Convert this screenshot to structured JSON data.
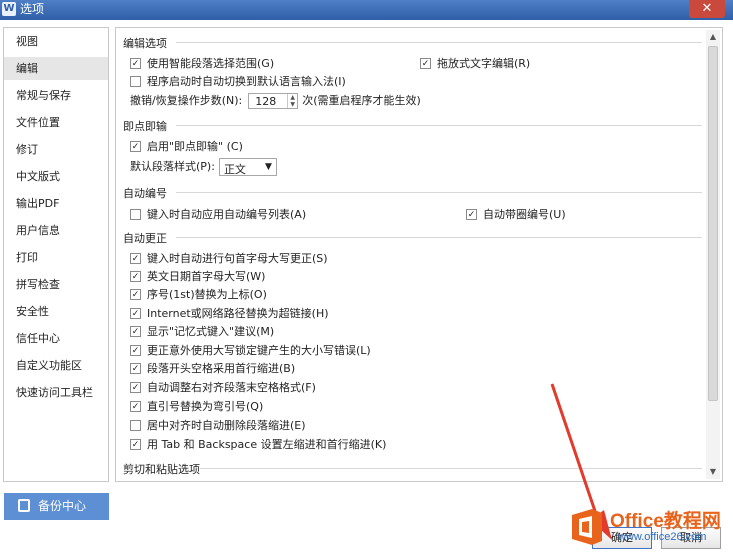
{
  "window": {
    "title": "选项",
    "close_label": "✕"
  },
  "sidebar": {
    "items": [
      {
        "label": "视图"
      },
      {
        "label": "编辑"
      },
      {
        "label": "常规与保存"
      },
      {
        "label": "文件位置"
      },
      {
        "label": "修订"
      },
      {
        "label": "中文版式"
      },
      {
        "label": "输出PDF"
      },
      {
        "label": "用户信息"
      },
      {
        "label": "打印"
      },
      {
        "label": "拼写检查"
      },
      {
        "label": "安全性"
      },
      {
        "label": "信任中心"
      },
      {
        "label": "自定义功能区"
      },
      {
        "label": "快速访问工具栏"
      }
    ],
    "active": "编辑",
    "backup_label": "备份中心"
  },
  "editing": {
    "title": "编辑选项",
    "smart_select": {
      "label": "使用智能段落选择范围(G)",
      "checked": true
    },
    "drag_edit": {
      "label": "拖放式文字编辑(R)",
      "checked": true
    },
    "auto_ime": {
      "label": "程序启动时自动切换到默认语言输入法(I)",
      "checked": false
    },
    "undo_steps": {
      "label": "撤销/恢复操作步数(N):",
      "value": "128",
      "note": "次(需重启程序才能生效)"
    }
  },
  "click_type": {
    "title": "即点即输",
    "enable": {
      "label": "启用\"即点即输\" (C)",
      "checked": true
    },
    "default_style": {
      "label": "默认段落样式(P):",
      "value": "正文"
    }
  },
  "auto_number": {
    "title": "自动编号",
    "auto_list": {
      "label": "键入时自动应用自动编号列表(A)",
      "checked": false
    },
    "circled": {
      "label": "自动带圈编号(U)",
      "checked": true
    }
  },
  "autocorrect": {
    "title": "自动更正",
    "items": [
      {
        "label": "键入时自动进行句首字母大写更正(S)",
        "checked": true
      },
      {
        "label": "英文日期首字母大写(W)",
        "checked": true
      },
      {
        "label": "序号(1st)替换为上标(O)",
        "checked": true
      },
      {
        "label": "Internet或网络路径替换为超链接(H)",
        "checked": true
      },
      {
        "label": "显示\"记忆式键入\"建议(M)",
        "checked": true
      },
      {
        "label": "更正意外使用大写锁定键产生的大小写错误(L)",
        "checked": true
      },
      {
        "label": "段落开头空格采用首行缩进(B)",
        "checked": true
      },
      {
        "label": "自动调整右对齐段落末空格格式(F)",
        "checked": true
      },
      {
        "label": "直引号替换为弯引号(Q)",
        "checked": true
      },
      {
        "label": "居中对齐时自动删除段落缩进(E)",
        "checked": false
      },
      {
        "label": "用 Tab 和 Backspace 设置左缩进和首行缩进(K)",
        "checked": true
      }
    ]
  },
  "paste": {
    "title": "剪切和粘贴选项"
  },
  "buttons": {
    "ok": "确定",
    "cancel": "取消"
  },
  "watermark": {
    "brand": "Office教程网",
    "url": "www.office26.com"
  },
  "colors": {
    "accent": "#5d8fd4",
    "arrow": "#e33a2c",
    "brand_orange": "#e8641c"
  }
}
